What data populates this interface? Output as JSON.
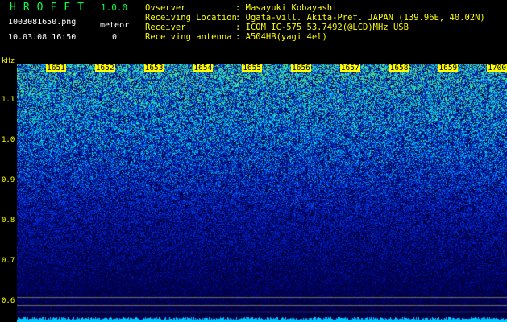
{
  "header": {
    "app_title": "HROFFT",
    "version": "1.0.0",
    "filename": "1003081650.png",
    "datetime": "10.03.08 16:50",
    "meteor_label": "meteor",
    "meteor_count": "0",
    "observer_key": "Ovserver",
    "observer_val": ": Masayuki Kobayashi",
    "location_key": "Receiving Location",
    "location_val": ": Ogata-vill. Akita-Pref. JAPAN (139.96E, 40.02N)",
    "receiver_key": "Receiver",
    "receiver_val": ": ICOM IC-575 53.7492(@LCD)MHz USB",
    "antenna_key": "Receiving antenna",
    "antenna_val": ": A504HB(yagi 4el)"
  },
  "axis": {
    "unit": "kHz",
    "y_ticks": [
      "1.1",
      "1.0",
      "0.9",
      "0.8",
      "0.7",
      "0.6"
    ],
    "time_labels": [
      "1651",
      "1652",
      "1653",
      "1654",
      "1655",
      "1656",
      "1657",
      "1658",
      "1659",
      "1700"
    ]
  },
  "colors": {
    "text_yellow": "#ffff00",
    "title_green": "#00ff44",
    "background": "#000000",
    "spectrum_low": "#00008a",
    "spectrum_high": "#40ff80"
  }
}
